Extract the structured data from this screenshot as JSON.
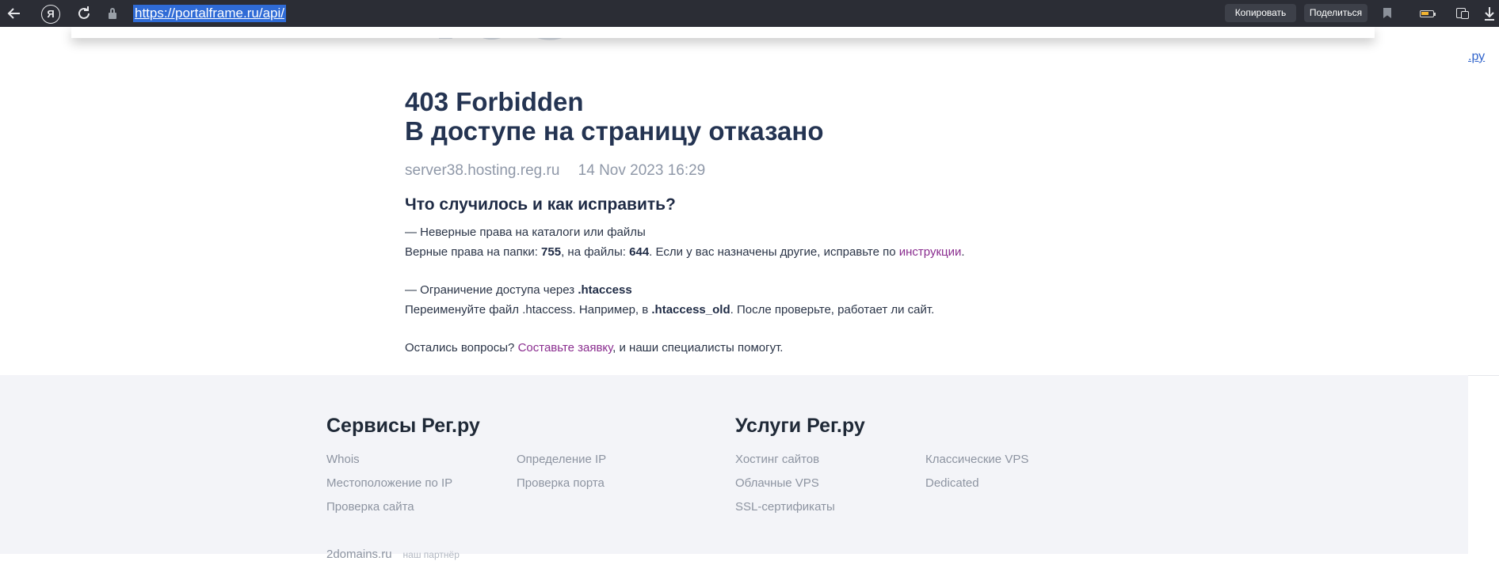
{
  "browser": {
    "url": "https://portalframe.ru/api/",
    "yandex_glyph": "Я",
    "copy_label": "Копировать",
    "share_label": "Поделиться",
    "edge_link": ".ру",
    "icons": [
      "back-arrow-icon",
      "yandex-logo-icon",
      "reload-icon",
      "lock-icon",
      "bookmark-icon",
      "battery-icon",
      "extensions-icon",
      "download-icon"
    ]
  },
  "error": {
    "big_code": "403",
    "title_line1": "403 Forbidden",
    "title_line2": "В доступе на страницу отказано",
    "server": "server38.hosting.reg.ru",
    "datetime": "14 Nov 2023 16:29"
  },
  "help": {
    "heading": "Что случилось и как исправить?",
    "item1_title": "— Неверные права на каталоги или файлы",
    "item1_text_a": "Верные права на папки: ",
    "item1_dirs": "755",
    "item1_text_b": ", на файлы: ",
    "item1_files": "644",
    "item1_text_c": ". Если у вас назначены другие, исправьте по ",
    "item1_link": "инструкции",
    "item1_text_d": ".",
    "item2_title_a": "— Ограничение доступа через ",
    "item2_title_b": ".htaccess",
    "item2_text_a": "Переименуйте файл .htaccess. Например, в ",
    "item2_text_b": ".htaccess_old",
    "item2_text_c": ". После проверьте, работает ли сайт.",
    "questions_a": "Остались вопросы? ",
    "questions_link": "Составьте заявку",
    "questions_b": ", и наши специалисты помогут."
  },
  "footer": {
    "services_title": "Сервисы Рег.ру",
    "services": [
      "Whois",
      "Определение IP",
      "Местоположение по IP",
      "Проверка порта",
      "Проверка сайта"
    ],
    "offers_title": "Услуги Рег.ру",
    "offers": [
      "Хостинг сайтов",
      "Классические VPS",
      "Облачные VPS",
      "Dedicated",
      "SSL-сертификаты"
    ],
    "cut_text": "2domains.ru",
    "cut_partner": "наш партнёр"
  },
  "colors": {
    "toolbar_bg": "#2b2d35",
    "url_highlight": "#2f6bd6",
    "heading": "#243452",
    "link": "#8a2d8f",
    "footer_bg": "#f3f4f8",
    "big_code": "#d8dde6"
  }
}
